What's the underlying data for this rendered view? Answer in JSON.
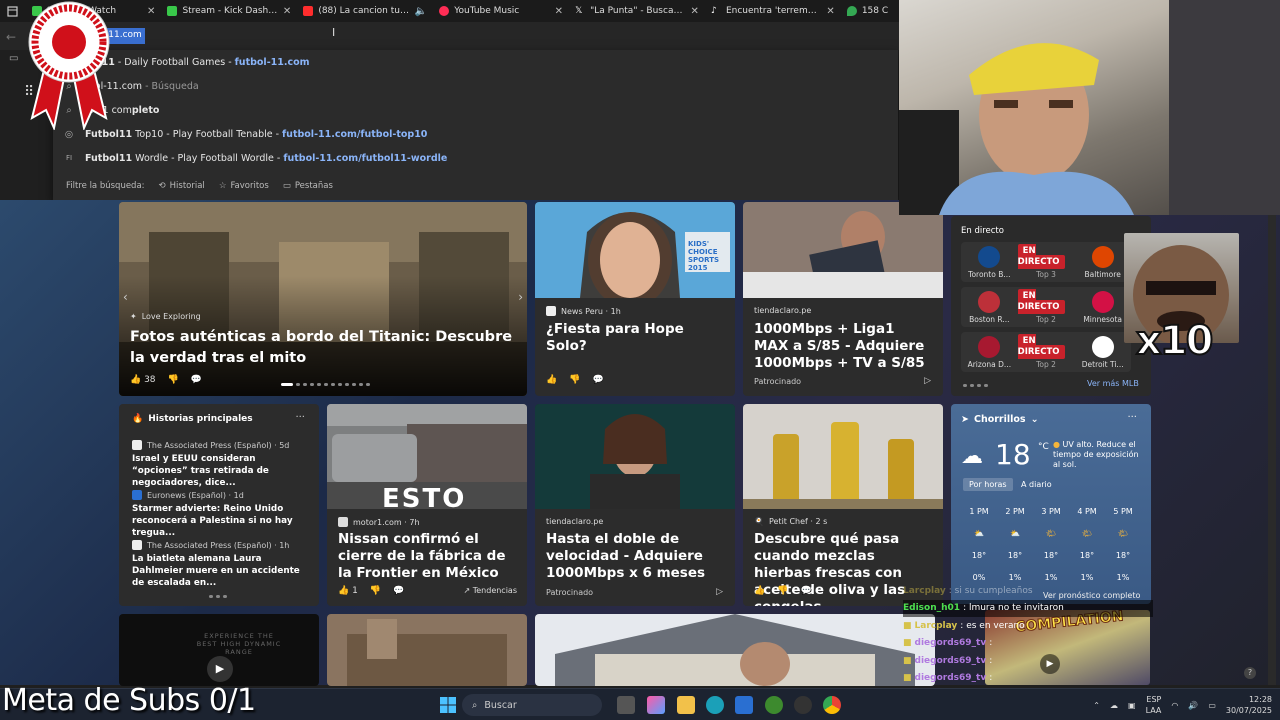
{
  "tabs": [
    {
      "title": "Stream - Watch",
      "fav": "#39c84a"
    },
    {
      "title": "Stream - Kick Dashboard",
      "fav": "#39c84a"
    },
    {
      "title": "(88) La cancion tu la que",
      "fav": "#ff2d2d"
    },
    {
      "title": "YouTube Music",
      "fav": "#ff2d55"
    },
    {
      "title": "\"La Punta\" - Buscar / X",
      "fav": "#ffffff"
    },
    {
      "title": "Encuentra 'terremoto 8.8' e",
      "fav": "#ffffff"
    },
    {
      "title": "158 C",
      "fav": "#34a853"
    }
  ],
  "address": {
    "selected_text": "ol-11.com"
  },
  "suggestions": [
    {
      "prefix": "",
      "bold": "bol11",
      "rest": " - Daily Football Games - ",
      "url": "futbol-11.com"
    },
    {
      "prefix": "",
      "bold": "",
      "rest": "tbol-11.com",
      "muted": " - Búsqueda"
    },
    {
      "prefix": "",
      "bold": "",
      "rest": "ol 11 com",
      "bold2": "pleto"
    },
    {
      "bold": "Futbol11",
      "rest": " Top10 - Play Football Tenable - ",
      "url": "futbol-11.com/futbol-top10"
    },
    {
      "bold": "Futbol11",
      "rest": " Wordle - Play Football Wordle - ",
      "url": "futbol-11.com/futbol11-wordle"
    }
  ],
  "filter": {
    "label": "Filtre la búsqueda:",
    "historial": "Historial",
    "favoritos": "Favoritos",
    "pestanas": "Pestañas"
  },
  "hero": {
    "source": "Love Exploring",
    "title": "Fotos auténticas a bordo del Titanic: Descubre la verdad tras el mito",
    "likes": "38"
  },
  "card_hope": {
    "source": "News Peru · 1h",
    "title": "¿Fiesta para Hope Solo?",
    "img_text": "KIDS' CHOICE SPORTS 2015"
  },
  "card_claro1": {
    "source": "tiendaclaro.pe",
    "title": "1000Mbps + Liga1 MAX a S/85 - Adquiere 1000Mbps + TV a S/85",
    "sponsor": "Patrocinado"
  },
  "live": {
    "header": "En directo",
    "badge": "EN DIRECTO",
    "more": "Ver más MLB",
    "games": [
      {
        "home": "Toronto B...",
        "away": "Baltimore",
        "inning": "Top 3",
        "hc": "#134a8e",
        "ac": "#df4601"
      },
      {
        "home": "Boston R...",
        "away": "Minnesota",
        "inning": "Top 2",
        "hc": "#bd3039",
        "ac": "#d31145"
      },
      {
        "home": "Arizona D...",
        "away": "Detroit Ti...",
        "inning": "Top 2",
        "hc": "#a71930",
        "ac": "#ffffff"
      }
    ]
  },
  "top_stories": {
    "header": "Historias principales",
    "items": [
      {
        "source": "The Associated Press (Español) · 5d",
        "title": "Israel y EEUU consideran “opciones” tras retirada de negociadores, dice..."
      },
      {
        "source": "Euronews (Español) · 1d",
        "title": "Starmer advierte: Reino Unido reconocerá a Palestina si no hay tregua..."
      },
      {
        "source": "The Associated Press (Español) · 1h",
        "title": "La biatleta alemana Laura Dahlmeier muere en un accidente de escalada en..."
      }
    ]
  },
  "card_nissan": {
    "source": "motor1.com · 7h",
    "title": "Nissan confirmó el cierre de la fábrica de la Frontier en México",
    "likes": "1",
    "trend": "Tendencias",
    "img_text": "ESTO"
  },
  "card_claro2": {
    "source": "tiendaclaro.pe",
    "title": "Hasta el doble de velocidad - Adquiere 1000Mbps x 6 meses",
    "sponsor": "Patrocinado"
  },
  "card_oil": {
    "source": "Petit Chef · 2 s",
    "title": "Descubre qué pasa cuando mezclas hierbas frescas con aceite de oliva y las congelas"
  },
  "weather": {
    "location": "Chorrillos",
    "temp": "18",
    "unit": "°C",
    "uv": "UV alto. Reduce el tiempo de exposición al sol.",
    "tab_hourly": "Por horas",
    "tab_daily": "A diario",
    "hours": [
      {
        "h": "1 PM",
        "t": "18°",
        "p": "0%",
        "icon": "cloudy"
      },
      {
        "h": "2 PM",
        "t": "18°",
        "p": "1%",
        "icon": "cloudy"
      },
      {
        "h": "3 PM",
        "t": "18°",
        "p": "1%",
        "icon": "partly"
      },
      {
        "h": "4 PM",
        "t": "18°",
        "p": "1%",
        "icon": "partly"
      },
      {
        "h": "5 PM",
        "t": "18°",
        "p": "1%",
        "icon": "partly"
      }
    ],
    "forecast": "Ver pronóstico completo"
  },
  "video": {
    "text": "EXPERIENCE THE BEST HIGH DYNAMIC RANGE"
  },
  "chat": [
    {
      "user": "Larcplay",
      "msg": ": si su cumpleaños",
      "color": "#d6c24a",
      "dim": true
    },
    {
      "user": "Edison_h01",
      "msg": ": lmura no te invitaron",
      "color": "#4ee04e",
      "dim": false
    },
    {
      "user": "Larcplay",
      "msg": ": es en verano",
      "color": "#d6c24a",
      "dim": false
    },
    {
      "user": "diegords69_tv",
      "msg": ":",
      "color": "#b07ae0",
      "dim": false
    },
    {
      "user": "diegords69_tv",
      "msg": ":",
      "color": "#b07ae0",
      "dim": false
    },
    {
      "user": "diegords69_tv",
      "msg": ":",
      "color": "#b07ae0",
      "dim": false
    },
    {
      "user": "diegords69_tv",
      "msg": ":",
      "color": "#b07ae0",
      "dim": false
    }
  ],
  "overlay": {
    "x10": "x10",
    "compilation": "COMPILATION",
    "meta": "Meta de Subs 0/1"
  },
  "taskbar": {
    "search": "Buscar",
    "lang": "ESP",
    "region": "LAA",
    "time": "12:28",
    "date": "30/07/2025"
  }
}
